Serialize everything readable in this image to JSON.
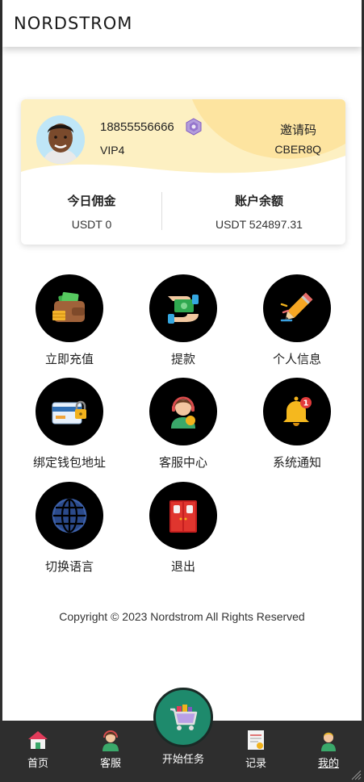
{
  "header": {
    "logo": "NORDSTROM"
  },
  "profile": {
    "phone": "18855556666",
    "vip": "VIP4",
    "invite_label": "邀请码",
    "invite_code": "CBER8Q"
  },
  "stats": {
    "today_commission_label": "今日佣金",
    "today_commission_value": "USDT 0",
    "balance_label": "账户余额",
    "balance_value": "USDT 524897.31"
  },
  "menu": [
    {
      "label": "立即充值",
      "icon": "wallet-icon"
    },
    {
      "label": "提款",
      "icon": "withdraw-cash-icon"
    },
    {
      "label": "个人信息",
      "icon": "pencil-icon"
    },
    {
      "label": "绑定钱包地址",
      "icon": "card-lock-icon"
    },
    {
      "label": "客服中心",
      "icon": "support-agent-icon"
    },
    {
      "label": "系统通知",
      "icon": "bell-icon"
    },
    {
      "label": "切换语言",
      "icon": "globe-icon"
    },
    {
      "label": "退出",
      "icon": "door-icon"
    }
  ],
  "notification_badge": "1",
  "copyright": "Copyright © 2023 Nordstrom All Rights Reserved",
  "tabbar": {
    "home": "首页",
    "service": "客服",
    "start_task": "开始任务",
    "records": "记录",
    "mine": "我的"
  },
  "colors": {
    "card_yellow": "#fdf0c2",
    "tabbar_bg": "#2e2e2e",
    "center_button": "#1e8a6c"
  }
}
